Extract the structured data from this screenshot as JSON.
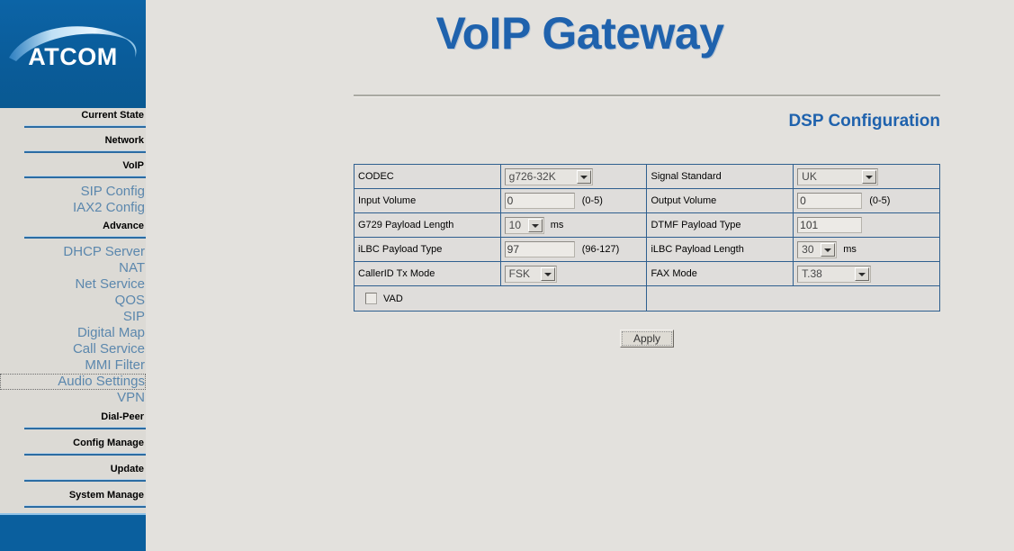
{
  "brand": {
    "logo_text": "ATCOM",
    "logo_icon": "swoosh-arc-icon"
  },
  "header": {
    "app_title": "VoIP Gateway",
    "page_subtitle": "DSP Configuration"
  },
  "sidebar": {
    "sections": [
      {
        "label": "Current State",
        "type": "head"
      },
      {
        "label": "Network",
        "type": "head"
      },
      {
        "label": "VoIP",
        "type": "head"
      },
      {
        "label": "SIP Config",
        "type": "sub"
      },
      {
        "label": "IAX2 Config",
        "type": "sub"
      },
      {
        "label": "Advance",
        "type": "head"
      },
      {
        "label": "DHCP Server",
        "type": "sub"
      },
      {
        "label": "NAT",
        "type": "sub"
      },
      {
        "label": "Net Service",
        "type": "sub"
      },
      {
        "label": "QOS",
        "type": "sub"
      },
      {
        "label": "SIP",
        "type": "sub"
      },
      {
        "label": "Digital Map",
        "type": "sub"
      },
      {
        "label": "Call Service",
        "type": "sub"
      },
      {
        "label": "MMI Filter",
        "type": "sub"
      },
      {
        "label": "Audio Settings",
        "type": "sub",
        "selected": true
      },
      {
        "label": "VPN",
        "type": "sub"
      },
      {
        "label": "Dial-Peer",
        "type": "head"
      },
      {
        "label": "Config Manage",
        "type": "head"
      },
      {
        "label": "Update",
        "type": "head"
      },
      {
        "label": "System Manage",
        "type": "head"
      }
    ]
  },
  "form": {
    "rows": [
      {
        "left_label": "CODEC",
        "left_control": "select",
        "left_value": "g726-32K",
        "right_label": "Signal Standard",
        "right_control": "select",
        "right_value": "UK"
      },
      {
        "left_label": "Input Volume",
        "left_control": "text",
        "left_value": "0",
        "left_hint": "(0-5)",
        "right_label": "Output Volume",
        "right_control": "text",
        "right_value": "0",
        "right_hint": "(0-5)"
      },
      {
        "left_label": "G729 Payload Length",
        "left_control": "select",
        "left_value": "10",
        "left_unit": "ms",
        "right_label": "DTMF Payload Type",
        "right_control": "text",
        "right_value": "101"
      },
      {
        "left_label": "iLBC Payload Type",
        "left_control": "text",
        "left_value": "97",
        "left_hint": "(96-127)",
        "right_label": "iLBC Payload Length",
        "right_control": "select",
        "right_value": "30",
        "right_unit": "ms"
      },
      {
        "left_label": "CallerID Tx Mode",
        "left_control": "select",
        "left_value": "FSK",
        "right_label": "FAX Mode",
        "right_control": "select",
        "right_value": "T.38"
      }
    ],
    "vad": {
      "label": "VAD",
      "checked": false
    }
  },
  "actions": {
    "apply_label": "Apply"
  },
  "colors": {
    "brand_blue": "#0a5f9e",
    "title_blue": "#1f62ad",
    "menu_link": "#5b87ad",
    "page_bg": "#e3e1dd",
    "table_border": "#2f5f8f"
  }
}
